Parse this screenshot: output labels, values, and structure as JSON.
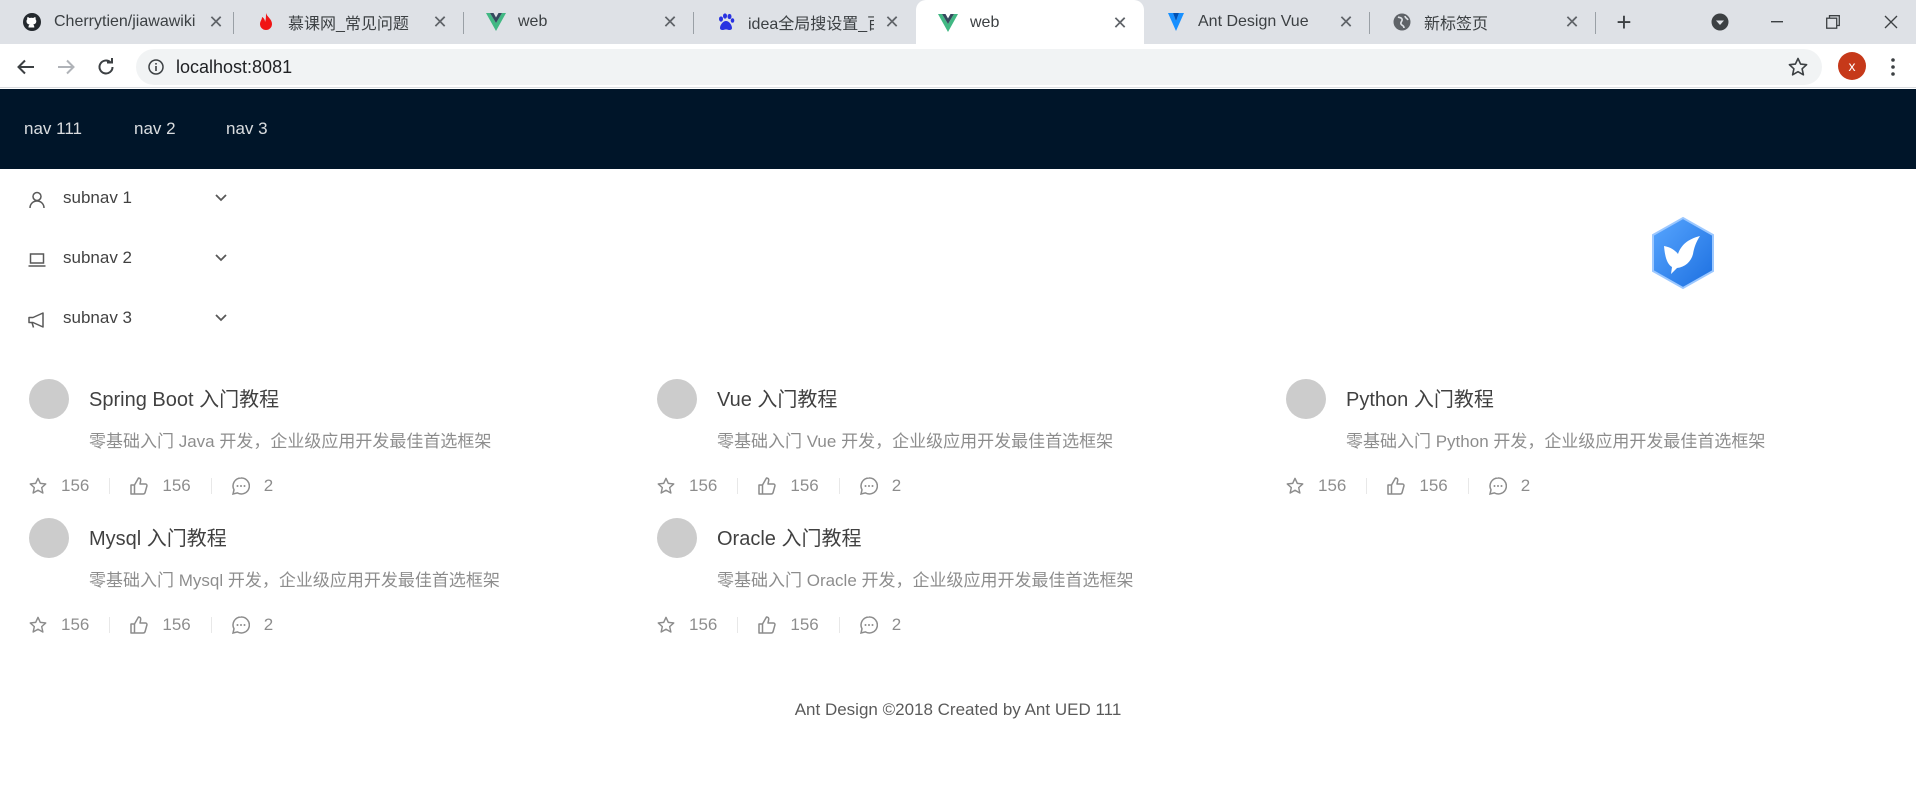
{
  "browser": {
    "tabs": [
      {
        "title": "Cherrytien/jiawawiki",
        "icon": "github-icon"
      },
      {
        "title": "慕课网_常见问题",
        "icon": "flame-icon"
      },
      {
        "title": "web",
        "icon": "vue-icon"
      },
      {
        "title": "idea全局搜设置_百度",
        "icon": "baidu-paw-icon"
      },
      {
        "title": "web",
        "icon": "vue-icon"
      },
      {
        "title": "Ant Design Vue",
        "icon": "antdv-shield-icon"
      },
      {
        "title": "新标签页",
        "icon": "globe-icon"
      }
    ],
    "active_tab_index": 4,
    "new_tab": "+",
    "url": "localhost:8081",
    "profile_initial": "x",
    "accent": "#c6391a"
  },
  "header": {
    "background": "#001529",
    "nav": [
      "nav 111",
      "nav 2",
      "nav 3"
    ]
  },
  "sider": {
    "submenus": [
      {
        "label": "subnav 1",
        "icon": "user-icon"
      },
      {
        "label": "subnav 2",
        "icon": "laptop-icon"
      },
      {
        "label": "subnav 3",
        "icon": "notification-icon"
      }
    ]
  },
  "logo": {
    "icon": "blue-bird-hexagon-logo"
  },
  "list": {
    "items": [
      {
        "title": "Spring Boot 入门教程",
        "description": "零基础入门 Java 开发，企业级应用开发最佳首选框架",
        "stars": "156",
        "likes": "156",
        "comments": "2"
      },
      {
        "title": "Vue 入门教程",
        "description": "零基础入门 Vue 开发，企业级应用开发最佳首选框架",
        "stars": "156",
        "likes": "156",
        "comments": "2"
      },
      {
        "title": "Python 入门教程",
        "description": "零基础入门 Python 开发，企业级应用开发最佳首选框架",
        "stars": "156",
        "likes": "156",
        "comments": "2"
      },
      {
        "title": "Mysql 入门教程",
        "description": "零基础入门 Mysql 开发，企业级应用开发最佳首选框架",
        "stars": "156",
        "likes": "156",
        "comments": "2"
      },
      {
        "title": "Oracle 入门教程",
        "description": "零基础入门 Oracle 开发，企业级应用开发最佳首选框架",
        "stars": "156",
        "likes": "156",
        "comments": "2"
      }
    ]
  },
  "footer": {
    "text": "Ant Design ©2018 Created by Ant UED 111"
  }
}
